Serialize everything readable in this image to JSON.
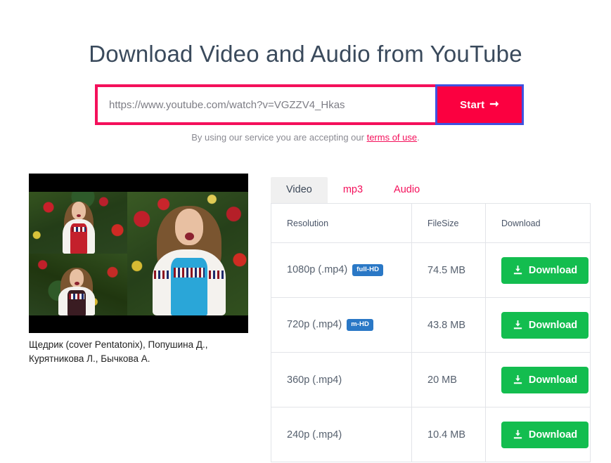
{
  "header": {
    "title": "Download Video and Audio from YouTube"
  },
  "search": {
    "url_value": "https://www.youtube.com/watch?v=VGZZV4_Hkas",
    "placeholder": "https://www.youtube.com/watch?v=...",
    "start_label": "Start",
    "arrow_icon": "arrow-right-icon"
  },
  "terms": {
    "prefix": "By using our service you are accepting our ",
    "link_label": "terms of use",
    "suffix": "."
  },
  "video": {
    "caption": "Щедрик (cover Pentatonix), Попушина Д., Курятникова Л., Бычкова А.",
    "thumbnail_alt": "video-thumbnail"
  },
  "tabs": [
    {
      "label": "Video",
      "active": true
    },
    {
      "label": "mp3",
      "active": false
    },
    {
      "label": "Audio",
      "active": false
    }
  ],
  "table": {
    "headers": [
      "Resolution",
      "FileSize",
      "Download"
    ],
    "rows": [
      {
        "resolution": "1080p (.mp4)",
        "badge": "full-HD",
        "filesize": "74.5 MB",
        "download_label": "Download"
      },
      {
        "resolution": "720p (.mp4)",
        "badge": "m-HD",
        "filesize": "43.8 MB",
        "download_label": "Download"
      },
      {
        "resolution": "360p (.mp4)",
        "badge": "",
        "filesize": "20 MB",
        "download_label": "Download"
      },
      {
        "resolution": "240p (.mp4)",
        "badge": "",
        "filesize": "10.4 MB",
        "download_label": "Download"
      }
    ]
  },
  "colors": {
    "accent_pink": "#f4105b",
    "start_red": "#fb0040",
    "focus_blue": "#3f51e0",
    "badge_blue": "#2a78c6",
    "download_green": "#13bd4f",
    "title_slate": "#3a4a5c"
  }
}
